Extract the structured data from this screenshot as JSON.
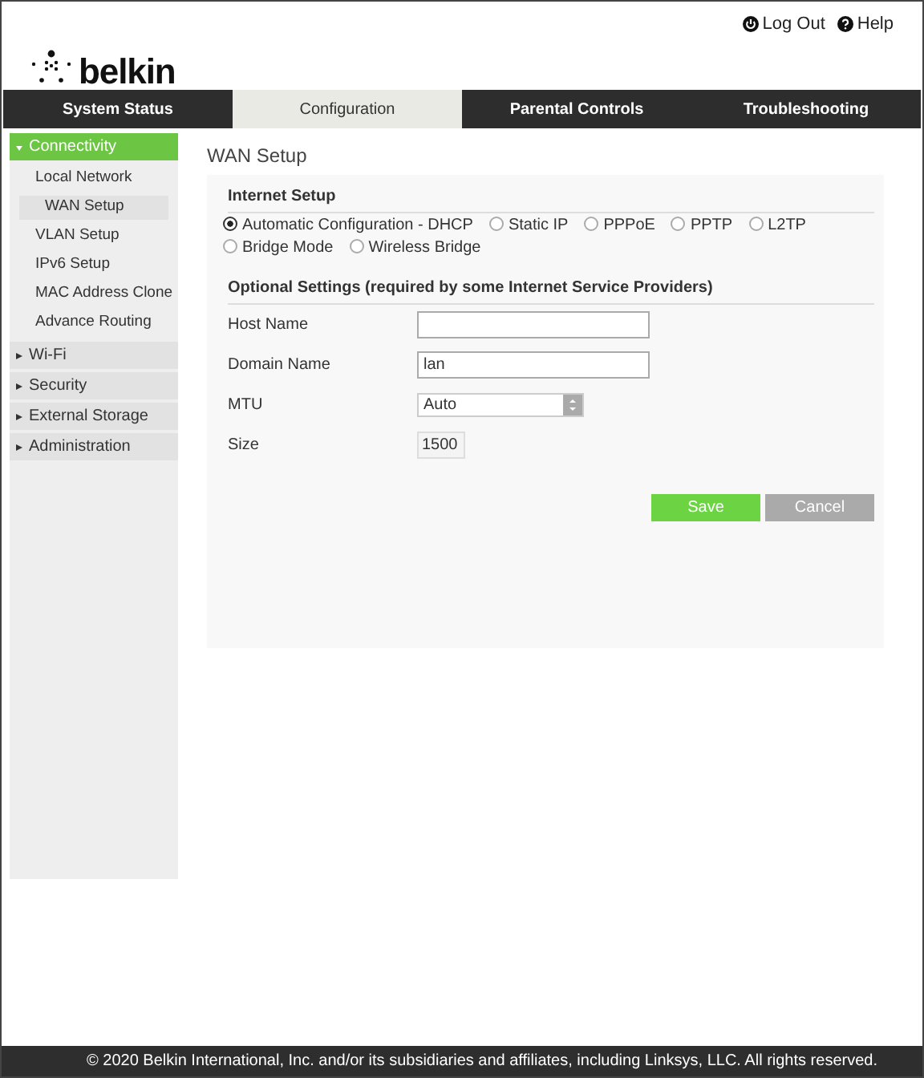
{
  "header": {
    "logo": "belkin",
    "links": [
      {
        "label": "Log Out",
        "kind": "logout"
      },
      {
        "label": "Help",
        "kind": "help"
      }
    ]
  },
  "tabs": [
    {
      "label": "System Status",
      "selected": false
    },
    {
      "label": "Configuration",
      "selected": true
    },
    {
      "label": "Parental Controls",
      "selected": false
    },
    {
      "label": "Troubleshooting",
      "selected": false
    }
  ],
  "sidebar": {
    "items": [
      {
        "label": "Connectivity",
        "selected": true,
        "expanded": true,
        "children": [
          {
            "label": "Local Network",
            "selected": false
          },
          {
            "label": "WAN Setup",
            "selected": true
          },
          {
            "label": "VLAN Setup",
            "selected": false
          },
          {
            "label": "IPv6 Setup",
            "selected": false
          },
          {
            "label": "MAC Address Clone",
            "selected": false
          },
          {
            "label": "Advance Routing",
            "selected": false
          }
        ]
      },
      {
        "label": "Wi-Fi",
        "selected": false,
        "expanded": false
      },
      {
        "label": "Security",
        "selected": false,
        "expanded": false
      },
      {
        "label": "External Storage",
        "selected": false,
        "expanded": false
      },
      {
        "label": "Administration",
        "selected": false,
        "expanded": false
      }
    ]
  },
  "page_title": "WAN Setup",
  "internet_setup": {
    "heading": "Internet Setup",
    "options": [
      {
        "label": "Automatic Configuration - DHCP",
        "selected": true
      },
      {
        "label": "Static IP",
        "selected": false
      },
      {
        "label": "PPPoE",
        "selected": false
      },
      {
        "label": "PPTP",
        "selected": false
      },
      {
        "label": "L2TP",
        "selected": false
      },
      {
        "label": "Bridge Mode",
        "selected": false
      },
      {
        "label": "Wireless Bridge",
        "selected": false
      }
    ]
  },
  "optional_settings": {
    "heading": "Optional Settings (required by some Internet Service Providers)",
    "fields": [
      {
        "label": "Host Name",
        "kind": "text"
      },
      {
        "label": "Domain Name",
        "kind": "text",
        "value": "lan"
      },
      {
        "label": "MTU",
        "kind": "select",
        "value": "Auto"
      },
      {
        "label": "Size",
        "kind": "number",
        "value": "1500"
      }
    ]
  },
  "buttons": [
    {
      "label": "Save",
      "kind": "primary"
    },
    {
      "label": "Cancel",
      "kind": "secondary"
    }
  ],
  "footer": "© 2020 Belkin International, Inc. and/or its subsidiaries and affiliates, including Linksys, LLC. All rights reserved."
}
